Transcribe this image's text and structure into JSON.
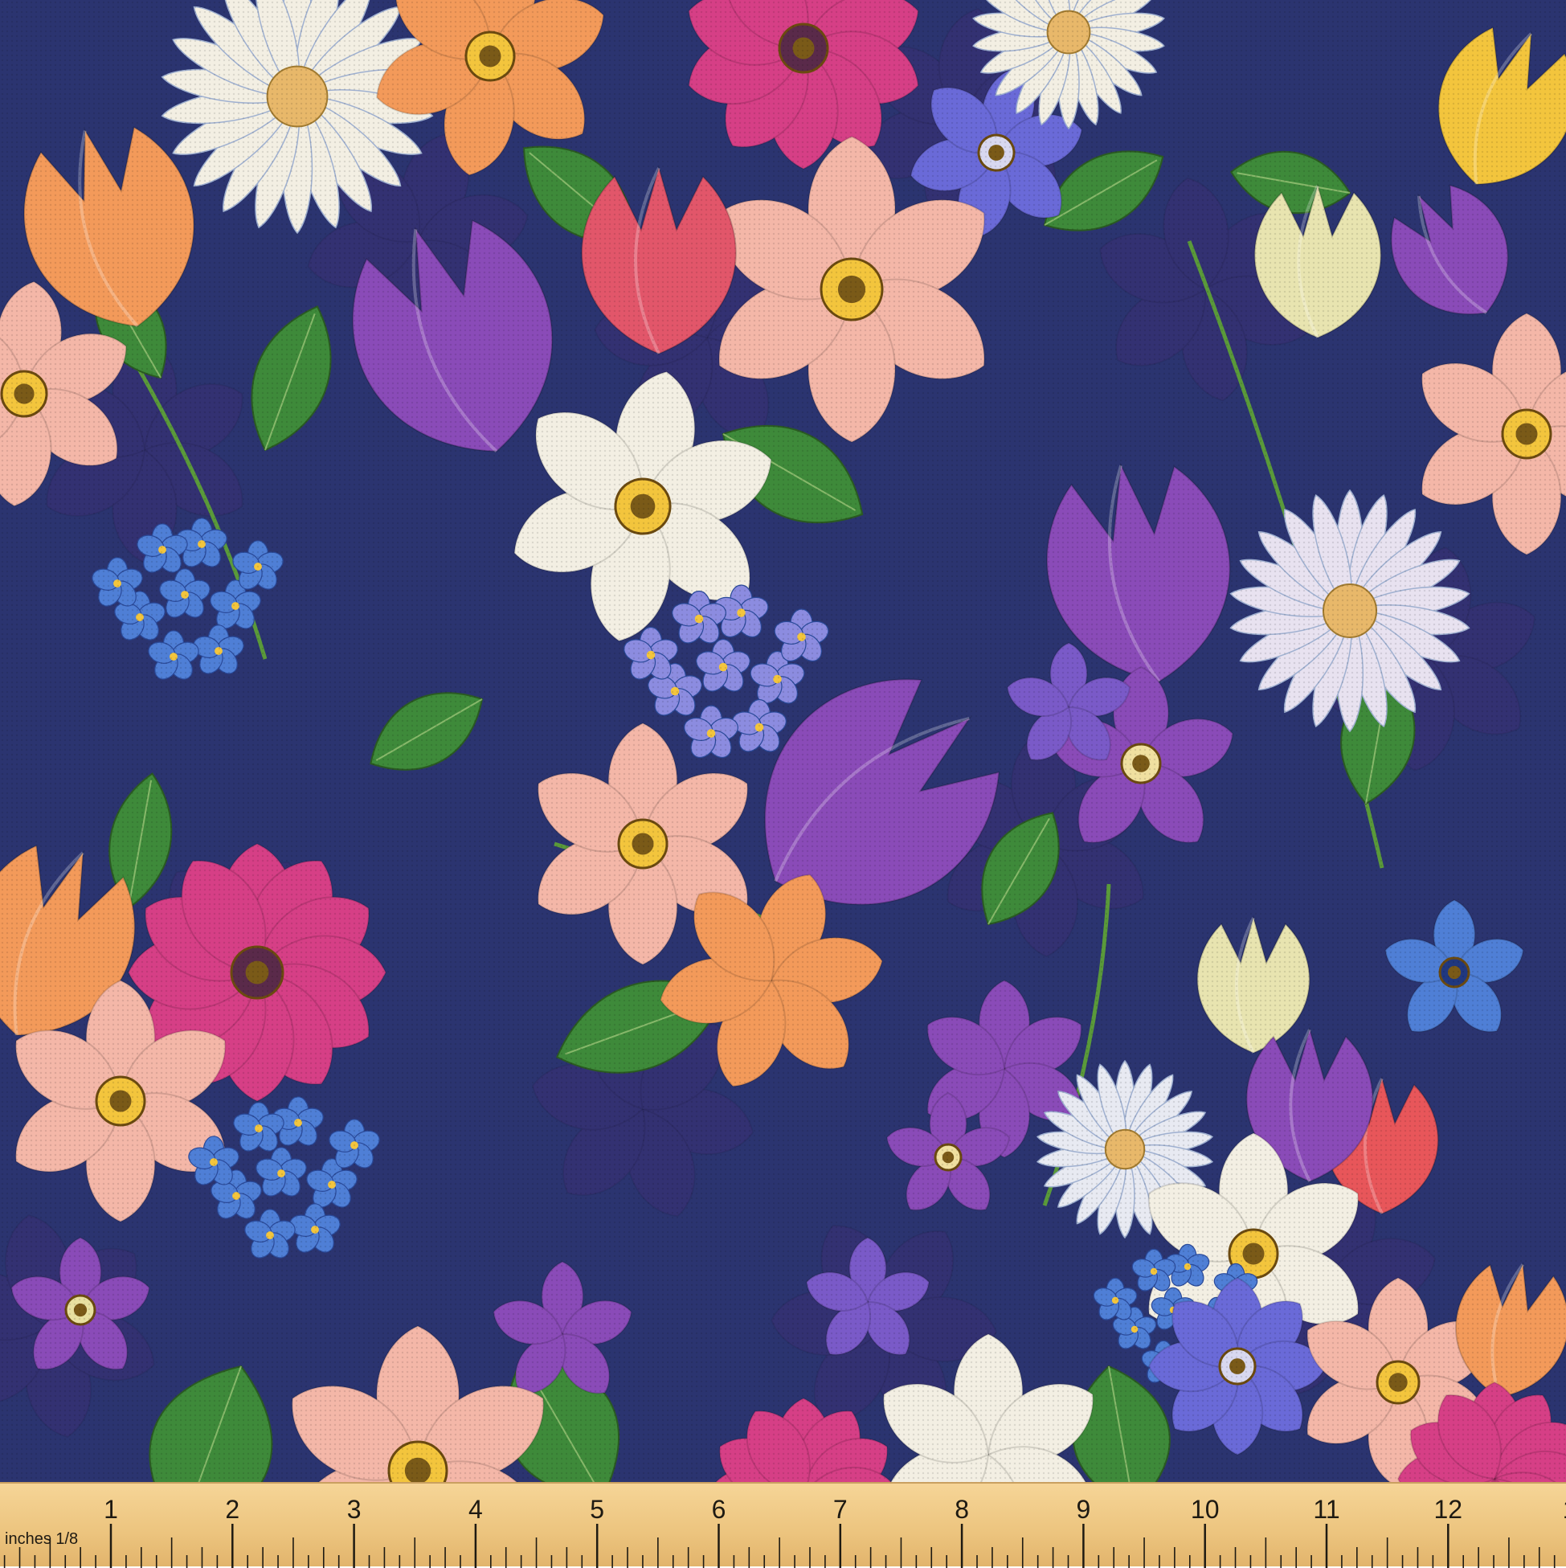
{
  "fabric": {
    "background": "#2b3470",
    "palette": {
      "pink": "#f4b7a8",
      "peach": "#f39a5a",
      "magenta": "#d63f86",
      "white": "#f3efe3",
      "violet": "#8a4bb8",
      "blue": "#4f7fd6",
      "leaf": "#3e8a3a",
      "yellow": "#f3c53d"
    }
  },
  "ruler": {
    "unit_label": "inches 1/8",
    "numbers": [
      "1",
      "2",
      "3",
      "4",
      "5",
      "6",
      "7",
      "8",
      "9",
      "10",
      "11",
      "12",
      "1"
    ]
  }
}
